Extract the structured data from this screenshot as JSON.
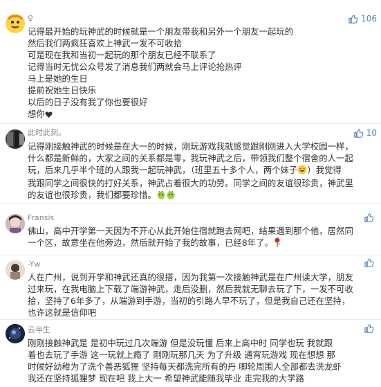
{
  "comments": [
    {
      "username": "♀",
      "likes": "106",
      "lines": [
        "记得最开始的玩神武的时候就是一个朋友带我和另外一个朋友一起玩的",
        "然后我们两疯狂喜欢上神武一发不可收拾",
        "可是现在我和当初一起玩的那个朋友已经不联系了",
        "记得当时无忧公众号发了消息我们两就会马上评论抢热评",
        "马上是她的生日",
        "提前祝她生日快乐",
        "以后的日子没有我了你也要很好",
        "想你"
      ]
    },
    {
      "username": "此时此刻。",
      "likes": "10",
      "lines": [
        "记得刚接触神武的时候是在大一的时候，刚玩游戏我就感觉跟刚刚进入大学校园一样，",
        "什么都是新鲜的，大家之间的关系都是零，我玩神武之后，带领我们整个宿舍的人一起",
        "玩，后来几乎半个班的人跟我一起玩神武，（班里五十多个人，两个妹子",
        "）我觉得",
        "我跟同学之间很快的打好关系，神武占着很大的功劳。同学之间的友谊很珍贵，神武里",
        "的友谊也很珍贵，我们都要珍惜。"
      ]
    },
    {
      "username": "Fransis",
      "likes": "",
      "lines": [
        "佛山，高中开学第一天因为不开心从此开始住宿就跑去网吧，结果遇到那个他，居然同",
        "一个区，故意坐在他旁边，然后就开始了我的故事，已经8年了。"
      ]
    },
    {
      "username": "-Yw",
      "likes": "",
      "lines": [
        "人在广州，说到开学和神武还真的很搭，因为我第一次接触神武是在广州读大学，朋友",
        "过来玩，在我电脑上下载了端游神武，走后没删，然后我就无聊去玩了下，一发不可收",
        "拾，坚持了6年多了，从端游到手游，当初的引路人早不玩了，但是我自己还在坚持，",
        "也许这就是信仰吧"
      ]
    },
    {
      "username": "云半生",
      "likes": "",
      "lines": [
        "刚刚接触神武是   是初中玩过几次端游  但是没玩懂   后来上高中时   同学也玩  我就跟",
        "着也去玩了手游  这一玩就上瘾了   刚刚玩那几天  为了升级   通宵玩游戏  现在想想  那",
        "时候好幼稚为了洗个善恶狐狸   坚持每天都洗完所有的丹   唧轮周围人全部都去洗龙虾",
        "我还在坚持狐狸梦   现在吧   我上大一   希望神武能随我毕业   走完我的大学路"
      ]
    }
  ]
}
